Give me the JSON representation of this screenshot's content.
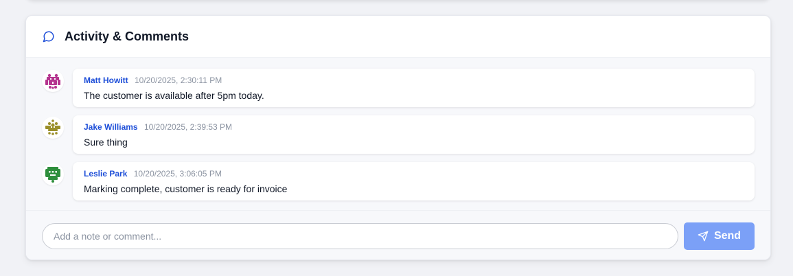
{
  "panel": {
    "title": "Activity & Comments",
    "icon": "message-circle-icon",
    "accent_color": "#1d4ed8"
  },
  "activity": [
    {
      "author": "Matt Howitt",
      "timestamp": "10/20/2025, 2:30:11 PM",
      "text": "The customer is available after 5pm today.",
      "avatar_color": "#b5348f"
    },
    {
      "author": "Jake Williams",
      "timestamp": "10/20/2025, 2:39:53 PM",
      "text": "Sure thing",
      "avatar_color": "#9a8f2a"
    },
    {
      "author": "Leslie Park",
      "timestamp": "10/20/2025, 3:06:05 PM",
      "text": "Marking complete, customer is ready for invoice",
      "avatar_color": "#2e8f3c"
    }
  ],
  "composer": {
    "placeholder": "Add a note or comment...",
    "value": "",
    "send_label": "Send",
    "send_icon": "send-icon",
    "send_color": "#7ba0f7"
  }
}
